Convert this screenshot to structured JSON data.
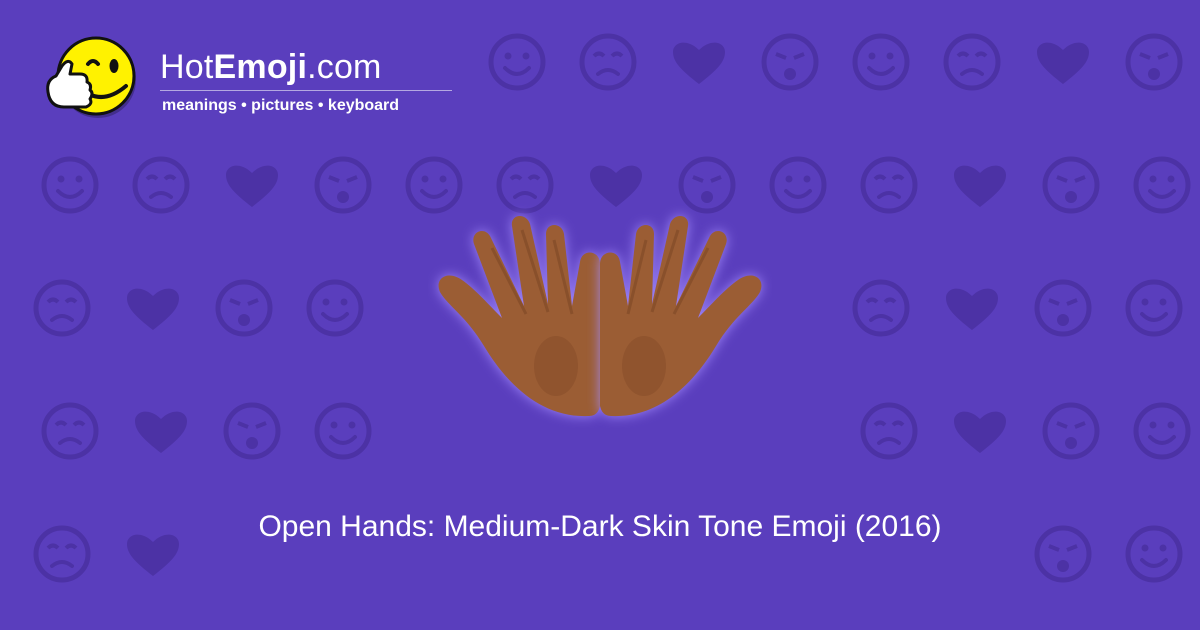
{
  "brand": {
    "prefix": "Hot",
    "bold": "Emoji",
    "suffix": ".com"
  },
  "tagline": "meanings • pictures • keyboard",
  "caption": "Open Hands: Medium-Dark Skin Tone Emoji (2016)",
  "colors": {
    "background": "#5a3ebd",
    "background_icons": "#4b31a3",
    "text": "#ffffff",
    "logo_face": "#fff200",
    "hand_skin": "#9b5d34",
    "hand_glow": "#a58cff"
  },
  "icons": {
    "logo": "thumbs-up-wink-smiley-icon",
    "hero": "open-hands-medium-dark-skin-tone-icon",
    "background_pattern": "emoji-pattern-icons"
  }
}
